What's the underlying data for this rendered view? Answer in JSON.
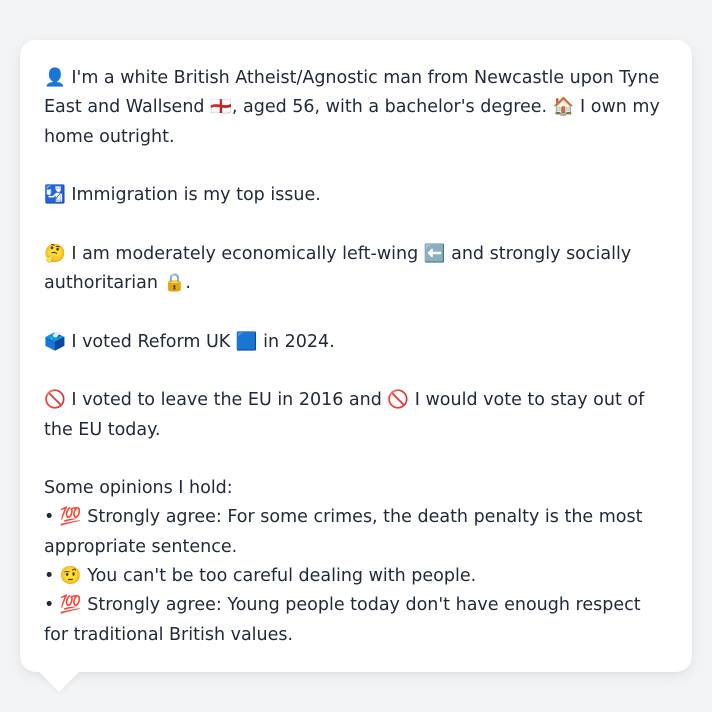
{
  "profile": {
    "intro": "👤 I'm a white British Atheist/Agnostic man from Newcastle upon Tyne East and Wallsend 🏴󠁧󠁢󠁥󠁮󠁧󠁿, aged 56, with a bachelor's degree. 🏠 I own my home outright.",
    "top_issue": "🛂 Immigration is my top issue.",
    "ideology": "🤔 I am moderately economically left-wing ⬅️ and strongly socially authoritarian 🔒.",
    "vote_2024": "🗳️ I voted Reform UK 🟦 in 2024.",
    "eu": "🚫 I voted to leave the EU in 2016 and 🚫 I would vote to stay out of the EU today.",
    "opinions_heading": "Some opinions I hold:",
    "opinions": [
      "• 💯 Strongly agree: For some crimes, the death penalty is the most appropriate sentence.",
      "• 🤨 You can't be too careful dealing with people.",
      "• 💯 Strongly agree: Young people today don't have enough respect for traditional British values."
    ]
  }
}
